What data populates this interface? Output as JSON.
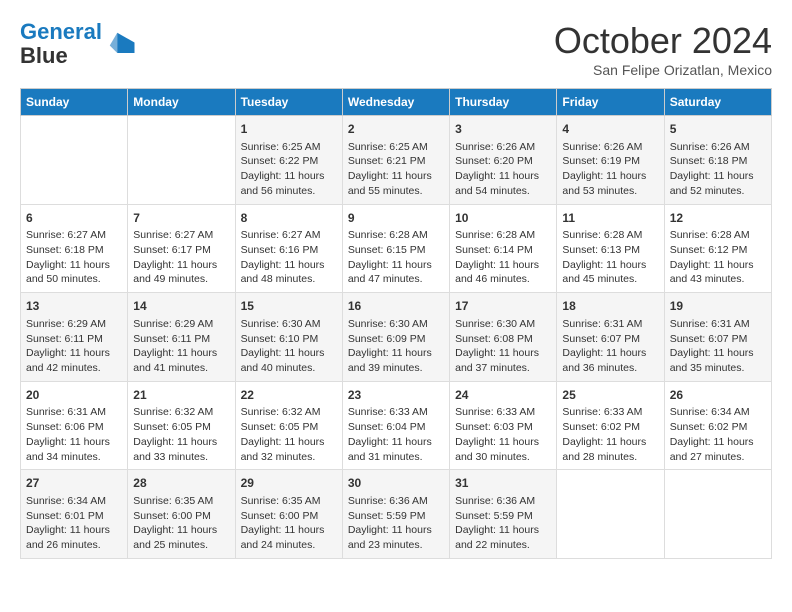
{
  "header": {
    "logo_line1": "General",
    "logo_line2": "Blue",
    "month_title": "October 2024",
    "location": "San Felipe Orizatlan, Mexico"
  },
  "weekdays": [
    "Sunday",
    "Monday",
    "Tuesday",
    "Wednesday",
    "Thursday",
    "Friday",
    "Saturday"
  ],
  "weeks": [
    [
      {
        "day": "",
        "sunrise": "",
        "sunset": "",
        "daylight": ""
      },
      {
        "day": "",
        "sunrise": "",
        "sunset": "",
        "daylight": ""
      },
      {
        "day": "1",
        "sunrise": "Sunrise: 6:25 AM",
        "sunset": "Sunset: 6:22 PM",
        "daylight": "Daylight: 11 hours and 56 minutes."
      },
      {
        "day": "2",
        "sunrise": "Sunrise: 6:25 AM",
        "sunset": "Sunset: 6:21 PM",
        "daylight": "Daylight: 11 hours and 55 minutes."
      },
      {
        "day": "3",
        "sunrise": "Sunrise: 6:26 AM",
        "sunset": "Sunset: 6:20 PM",
        "daylight": "Daylight: 11 hours and 54 minutes."
      },
      {
        "day": "4",
        "sunrise": "Sunrise: 6:26 AM",
        "sunset": "Sunset: 6:19 PM",
        "daylight": "Daylight: 11 hours and 53 minutes."
      },
      {
        "day": "5",
        "sunrise": "Sunrise: 6:26 AM",
        "sunset": "Sunset: 6:18 PM",
        "daylight": "Daylight: 11 hours and 52 minutes."
      }
    ],
    [
      {
        "day": "6",
        "sunrise": "Sunrise: 6:27 AM",
        "sunset": "Sunset: 6:18 PM",
        "daylight": "Daylight: 11 hours and 50 minutes."
      },
      {
        "day": "7",
        "sunrise": "Sunrise: 6:27 AM",
        "sunset": "Sunset: 6:17 PM",
        "daylight": "Daylight: 11 hours and 49 minutes."
      },
      {
        "day": "8",
        "sunrise": "Sunrise: 6:27 AM",
        "sunset": "Sunset: 6:16 PM",
        "daylight": "Daylight: 11 hours and 48 minutes."
      },
      {
        "day": "9",
        "sunrise": "Sunrise: 6:28 AM",
        "sunset": "Sunset: 6:15 PM",
        "daylight": "Daylight: 11 hours and 47 minutes."
      },
      {
        "day": "10",
        "sunrise": "Sunrise: 6:28 AM",
        "sunset": "Sunset: 6:14 PM",
        "daylight": "Daylight: 11 hours and 46 minutes."
      },
      {
        "day": "11",
        "sunrise": "Sunrise: 6:28 AM",
        "sunset": "Sunset: 6:13 PM",
        "daylight": "Daylight: 11 hours and 45 minutes."
      },
      {
        "day": "12",
        "sunrise": "Sunrise: 6:28 AM",
        "sunset": "Sunset: 6:12 PM",
        "daylight": "Daylight: 11 hours and 43 minutes."
      }
    ],
    [
      {
        "day": "13",
        "sunrise": "Sunrise: 6:29 AM",
        "sunset": "Sunset: 6:11 PM",
        "daylight": "Daylight: 11 hours and 42 minutes."
      },
      {
        "day": "14",
        "sunrise": "Sunrise: 6:29 AM",
        "sunset": "Sunset: 6:11 PM",
        "daylight": "Daylight: 11 hours and 41 minutes."
      },
      {
        "day": "15",
        "sunrise": "Sunrise: 6:30 AM",
        "sunset": "Sunset: 6:10 PM",
        "daylight": "Daylight: 11 hours and 40 minutes."
      },
      {
        "day": "16",
        "sunrise": "Sunrise: 6:30 AM",
        "sunset": "Sunset: 6:09 PM",
        "daylight": "Daylight: 11 hours and 39 minutes."
      },
      {
        "day": "17",
        "sunrise": "Sunrise: 6:30 AM",
        "sunset": "Sunset: 6:08 PM",
        "daylight": "Daylight: 11 hours and 37 minutes."
      },
      {
        "day": "18",
        "sunrise": "Sunrise: 6:31 AM",
        "sunset": "Sunset: 6:07 PM",
        "daylight": "Daylight: 11 hours and 36 minutes."
      },
      {
        "day": "19",
        "sunrise": "Sunrise: 6:31 AM",
        "sunset": "Sunset: 6:07 PM",
        "daylight": "Daylight: 11 hours and 35 minutes."
      }
    ],
    [
      {
        "day": "20",
        "sunrise": "Sunrise: 6:31 AM",
        "sunset": "Sunset: 6:06 PM",
        "daylight": "Daylight: 11 hours and 34 minutes."
      },
      {
        "day": "21",
        "sunrise": "Sunrise: 6:32 AM",
        "sunset": "Sunset: 6:05 PM",
        "daylight": "Daylight: 11 hours and 33 minutes."
      },
      {
        "day": "22",
        "sunrise": "Sunrise: 6:32 AM",
        "sunset": "Sunset: 6:05 PM",
        "daylight": "Daylight: 11 hours and 32 minutes."
      },
      {
        "day": "23",
        "sunrise": "Sunrise: 6:33 AM",
        "sunset": "Sunset: 6:04 PM",
        "daylight": "Daylight: 11 hours and 31 minutes."
      },
      {
        "day": "24",
        "sunrise": "Sunrise: 6:33 AM",
        "sunset": "Sunset: 6:03 PM",
        "daylight": "Daylight: 11 hours and 30 minutes."
      },
      {
        "day": "25",
        "sunrise": "Sunrise: 6:33 AM",
        "sunset": "Sunset: 6:02 PM",
        "daylight": "Daylight: 11 hours and 28 minutes."
      },
      {
        "day": "26",
        "sunrise": "Sunrise: 6:34 AM",
        "sunset": "Sunset: 6:02 PM",
        "daylight": "Daylight: 11 hours and 27 minutes."
      }
    ],
    [
      {
        "day": "27",
        "sunrise": "Sunrise: 6:34 AM",
        "sunset": "Sunset: 6:01 PM",
        "daylight": "Daylight: 11 hours and 26 minutes."
      },
      {
        "day": "28",
        "sunrise": "Sunrise: 6:35 AM",
        "sunset": "Sunset: 6:00 PM",
        "daylight": "Daylight: 11 hours and 25 minutes."
      },
      {
        "day": "29",
        "sunrise": "Sunrise: 6:35 AM",
        "sunset": "Sunset: 6:00 PM",
        "daylight": "Daylight: 11 hours and 24 minutes."
      },
      {
        "day": "30",
        "sunrise": "Sunrise: 6:36 AM",
        "sunset": "Sunset: 5:59 PM",
        "daylight": "Daylight: 11 hours and 23 minutes."
      },
      {
        "day": "31",
        "sunrise": "Sunrise: 6:36 AM",
        "sunset": "Sunset: 5:59 PM",
        "daylight": "Daylight: 11 hours and 22 minutes."
      },
      {
        "day": "",
        "sunrise": "",
        "sunset": "",
        "daylight": ""
      },
      {
        "day": "",
        "sunrise": "",
        "sunset": "",
        "daylight": ""
      }
    ]
  ]
}
